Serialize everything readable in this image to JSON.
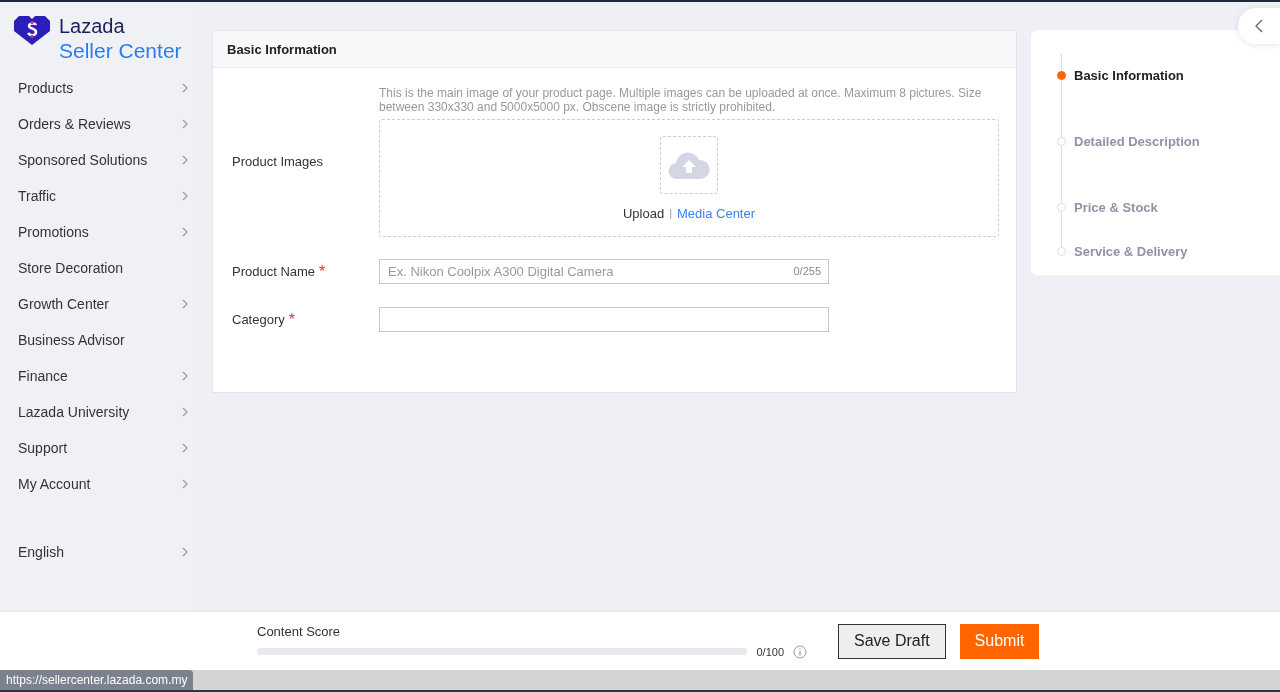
{
  "brand": {
    "name": "Lazada",
    "product": "Seller Center"
  },
  "sidebar": {
    "items": [
      {
        "label": "Products",
        "expandable": true
      },
      {
        "label": "Orders & Reviews",
        "expandable": true
      },
      {
        "label": "Sponsored Solutions",
        "expandable": true
      },
      {
        "label": "Traffic",
        "expandable": true
      },
      {
        "label": "Promotions",
        "expandable": true
      },
      {
        "label": "Store Decoration",
        "expandable": false
      },
      {
        "label": "Growth Center",
        "expandable": true
      },
      {
        "label": "Business Advisor",
        "expandable": false
      },
      {
        "label": "Finance",
        "expandable": true
      },
      {
        "label": "Lazada University",
        "expandable": true
      },
      {
        "label": "Support",
        "expandable": true
      },
      {
        "label": "My Account",
        "expandable": true
      }
    ],
    "language": {
      "label": "English",
      "expandable": true
    }
  },
  "form": {
    "title": "Basic Information",
    "images": {
      "label": "Product Images",
      "hint": "This is the main image of your product page. Multiple images can be uploaded at once. Maximum 8 pictures. Size between 330x330 and 5000x5000 px. Obscene image is strictly prohibited.",
      "upload": "Upload",
      "separator": "|",
      "media_link": "Media Center"
    },
    "fields": [
      {
        "label": "Product Name",
        "required_mark": "*",
        "placeholder": "Ex. Nikon Coolpix A300 Digital Camera",
        "counter": "0/255"
      },
      {
        "label": "Category",
        "required_mark": "*"
      }
    ]
  },
  "steps": [
    {
      "label": "Basic Information",
      "selected": true
    },
    {
      "label": "Detailed Description",
      "selected": false
    },
    {
      "label": "Price & Stock",
      "selected": false
    },
    {
      "label": "Service & Delivery",
      "selected": false
    }
  ],
  "footer": {
    "score_label": "Content Score",
    "level": 0,
    "score": "0/100",
    "buttons": [
      {
        "label": "Save Draft",
        "kind": "secondary"
      },
      {
        "label": "Submit",
        "kind": "primary"
      }
    ]
  },
  "status_bar": {
    "url": "https://sellercenter.lazada.com.my"
  }
}
